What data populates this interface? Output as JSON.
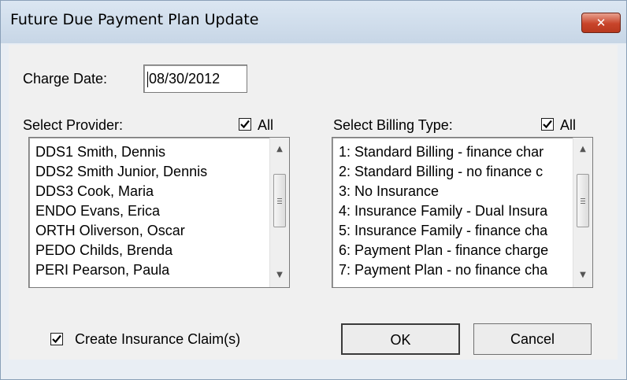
{
  "window": {
    "title": "Future Due Payment Plan Update",
    "close_glyph": "✕"
  },
  "charge_date": {
    "label": "Charge Date:",
    "value": "08/30/2012"
  },
  "provider": {
    "label": "Select Provider:",
    "all_label": "All",
    "all_checked": true,
    "items": [
      "DDS1 Smith, Dennis",
      "DDS2 Smith Junior, Dennis",
      "DDS3 Cook, Maria",
      "ENDO Evans, Erica",
      "ORTH Oliverson, Oscar",
      "PEDO Childs, Brenda",
      "PERI Pearson, Paula"
    ]
  },
  "billing": {
    "label": "Select Billing Type:",
    "all_label": "All",
    "all_checked": true,
    "items": [
      "1: Standard Billing - finance char",
      "2: Standard Billing - no finance c",
      "3: No Insurance",
      "4: Insurance Family - Dual Insura",
      "5: Insurance Family - finance cha",
      "6: Payment Plan - finance charge",
      "7: Payment Plan - no finance cha"
    ]
  },
  "insurance_claim": {
    "label": "Create Insurance Claim(s)",
    "checked": true
  },
  "buttons": {
    "ok": "OK",
    "cancel": "Cancel"
  },
  "icons": {
    "scroll_up": "▲",
    "scroll_down": "▼"
  }
}
